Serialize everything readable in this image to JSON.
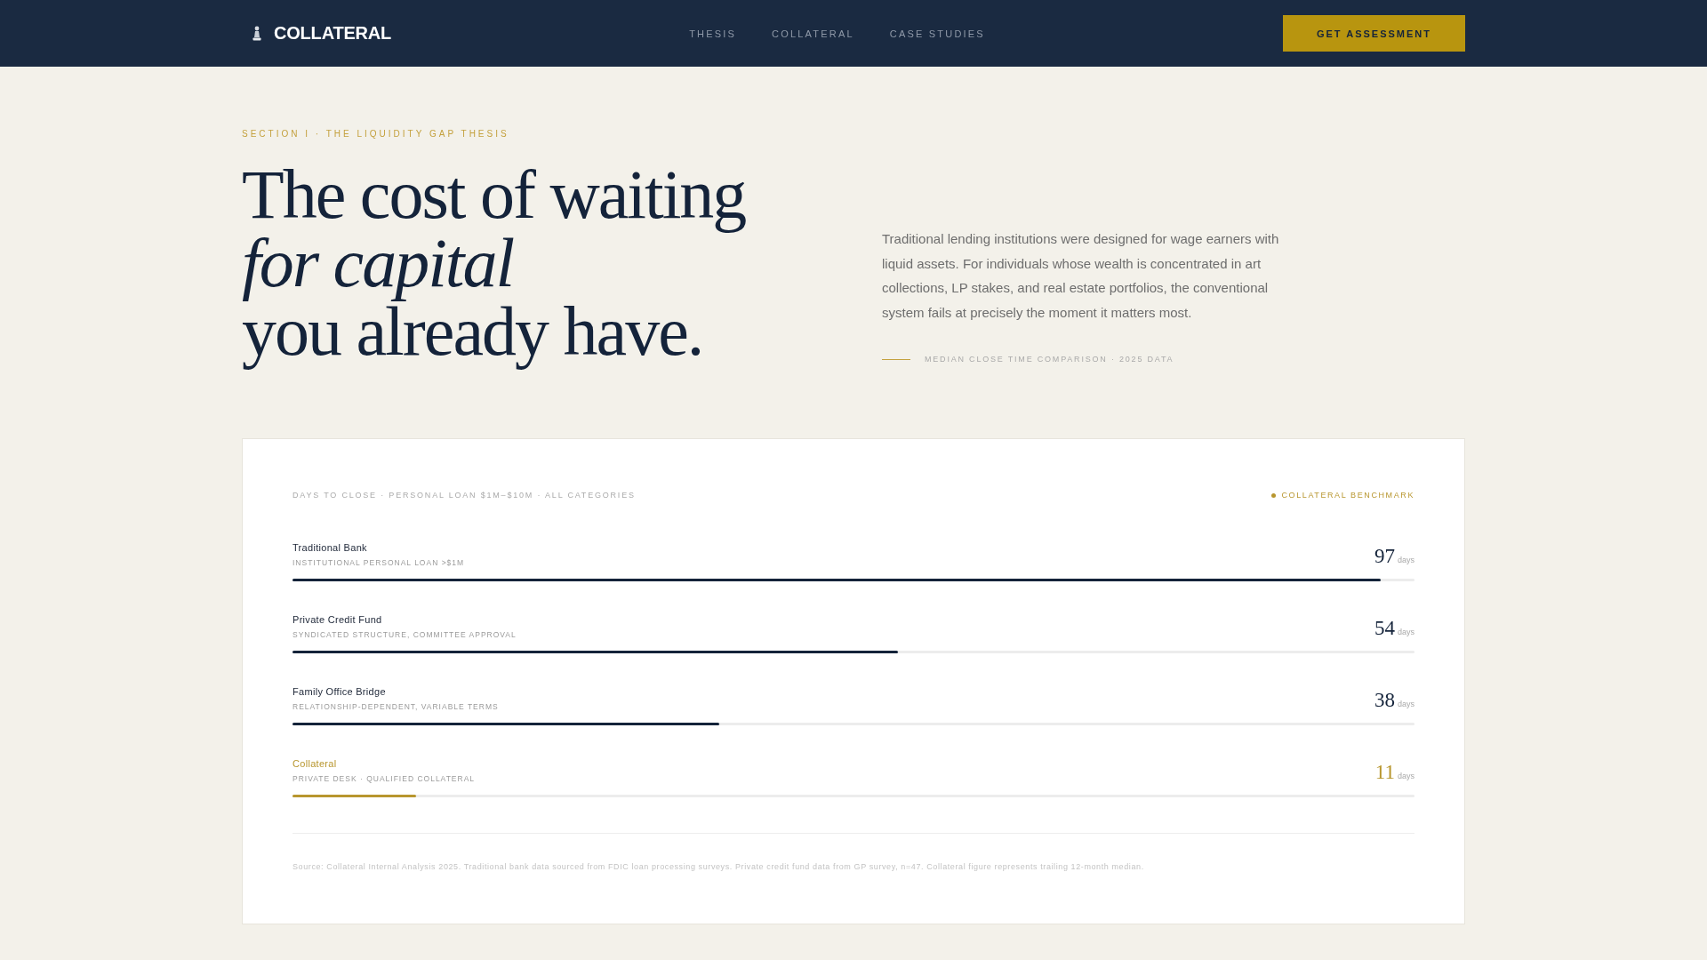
{
  "nav": {
    "brand": "COLLATERAL",
    "links": [
      "THESIS",
      "COLLATERAL",
      "CASE STUDIES"
    ],
    "cta": "GET ASSESSMENT"
  },
  "hero": {
    "eyebrow": "SECTION I · THE LIQUIDITY GAP THESIS",
    "headline": "The cost of waiting\n*for capital*\nyou already have.",
    "body": "Traditional lending institutions were designed for wage earners with liquid assets. For individuals whose wealth is concentrated in art collections, LP stakes, and real estate portfolios, the conventional system fails at precisely the moment it matters most.",
    "meta": "MEDIAN CLOSE TIME COMPARISON · 2025 DATA"
  },
  "comparison": {
    "caption": "DAYS TO CLOSE · PERSONAL LOAN $1M–$10M · ALL CATEGORIES",
    "legend": "COLLATERAL BENCHMARK",
    "rows": [
      {
        "name": "Traditional Bank",
        "detail": "INSTITUTIONAL PERSONAL LOAN >$1M",
        "value": "97",
        "unit": "days",
        "level": 0.97,
        "benchmark": false
      },
      {
        "name": "Private Credit Fund",
        "detail": "SYNDICATED STRUCTURE, COMMITTEE APPROVAL",
        "value": "54",
        "unit": "days",
        "level": 0.54,
        "benchmark": false
      },
      {
        "name": "Family Office Bridge",
        "detail": "RELATIONSHIP-DEPENDENT, VARIABLE TERMS",
        "value": "38",
        "unit": "days",
        "level": 0.38,
        "benchmark": false
      },
      {
        "name": "Collateral",
        "detail": "PRIVATE DESK · QUALIFIED COLLATERAL",
        "value": "11",
        "unit": "days",
        "level": 0.11,
        "benchmark": true
      }
    ],
    "source": "Source: Collateral Internal Analysis 2025. Traditional bank data sourced from FDIC loan processing surveys. Private credit fund data from GP survey, n=47. Collateral figure represents trailing 12-month median."
  }
}
